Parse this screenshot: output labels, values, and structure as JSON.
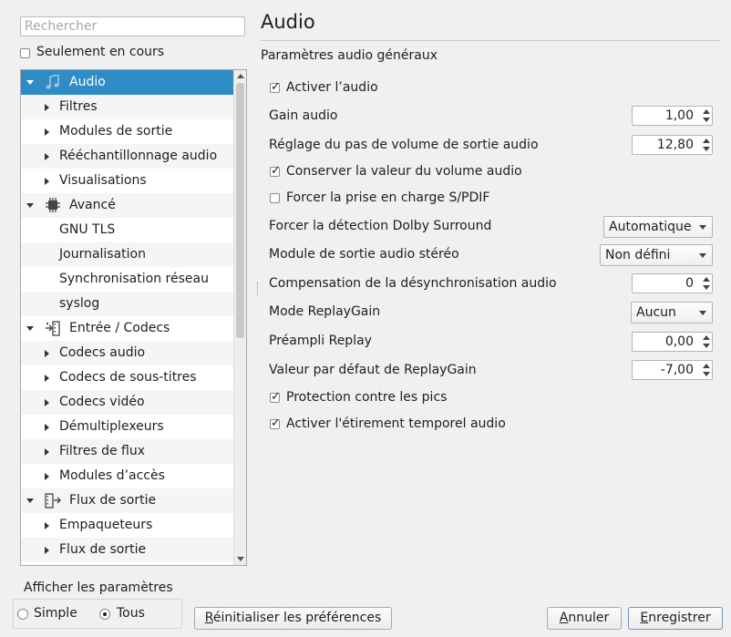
{
  "search": {
    "placeholder": "Rechercher"
  },
  "only_current": {
    "label": "Seulement en cours",
    "checked": false
  },
  "tree": {
    "items": [
      {
        "label": "Audio",
        "level": 0,
        "expanded": true,
        "icon": "music-note-icon",
        "selected": true
      },
      {
        "label": "Filtres",
        "level": 1,
        "expander": true
      },
      {
        "label": "Modules de sortie",
        "level": 1,
        "expander": true
      },
      {
        "label": "Rééchantillonnage audio",
        "level": 1,
        "expander": true
      },
      {
        "label": "Visualisations",
        "level": 1,
        "expander": true
      },
      {
        "label": "Avancé",
        "level": 0,
        "expanded": true,
        "icon": "cpu-chip-icon"
      },
      {
        "label": "GNU TLS",
        "level": 1,
        "expander": false
      },
      {
        "label": "Journalisation",
        "level": 1,
        "expander": false
      },
      {
        "label": "Synchronisation réseau",
        "level": 1,
        "expander": false
      },
      {
        "label": "syslog",
        "level": 1,
        "expander": false
      },
      {
        "label": "Entrée / Codecs",
        "level": 0,
        "expanded": true,
        "icon": "input-codecs-icon"
      },
      {
        "label": "Codecs audio",
        "level": 1,
        "expander": true
      },
      {
        "label": "Codecs de sous-titres",
        "level": 1,
        "expander": true
      },
      {
        "label": "Codecs vidéo",
        "level": 1,
        "expander": true
      },
      {
        "label": "Démultiplexeurs",
        "level": 1,
        "expander": true
      },
      {
        "label": "Filtres de flux",
        "level": 1,
        "expander": true
      },
      {
        "label": "Modules d’accès",
        "level": 1,
        "expander": true
      },
      {
        "label": "Flux de sortie",
        "level": 0,
        "expanded": true,
        "icon": "stream-output-icon"
      },
      {
        "label": "Empaqueteurs",
        "level": 1,
        "expander": true
      },
      {
        "label": "Flux de sortie",
        "level": 1,
        "expander": true
      }
    ]
  },
  "panel": {
    "title": "Audio",
    "section": "Paramètres audio généraux",
    "enable_audio": {
      "label": "Activer l’audio",
      "checked": true
    },
    "gain": {
      "label": "Gain audio",
      "value": "1,00"
    },
    "volume_step": {
      "label": "Réglage du pas de volume de sortie audio",
      "value": "12,80"
    },
    "keep_volume": {
      "label": "Conserver la valeur du volume audio",
      "checked": true
    },
    "force_spdif": {
      "label": "Forcer la prise en charge S/PDIF",
      "checked": false
    },
    "dolby": {
      "label": "Forcer la détection Dolby Surround",
      "value": "Automatique"
    },
    "stereo": {
      "label": "Module de sortie audio stéréo",
      "value": "Non défini"
    },
    "desync": {
      "label": "Compensation de la désynchronisation audio",
      "value": "0"
    },
    "replaygain_mode": {
      "label": "Mode ReplayGain",
      "value": "Aucun"
    },
    "preamp": {
      "label": "Préampli Replay",
      "value": "0,00"
    },
    "replaygain_default": {
      "label": "Valeur par défaut de ReplayGain",
      "value": "-7,00"
    },
    "peak_protection": {
      "label": "Protection contre les pics",
      "checked": true
    },
    "time_stretch": {
      "label": "Activer l'étirement temporel audio",
      "checked": true
    }
  },
  "show_settings": {
    "label": "Afficher les paramètres",
    "simple": {
      "label": "Simple",
      "selected": false
    },
    "all": {
      "label": "Tous",
      "selected": true
    }
  },
  "buttons": {
    "reset": {
      "first": "R",
      "rest": "éinitialiser les préférences"
    },
    "cancel": {
      "first": "A",
      "rest": "nnuler"
    },
    "save": {
      "first": "E",
      "rest": "nregistrer"
    }
  },
  "colors": {
    "selection": "#308cc6",
    "background": "#f0f0f0"
  }
}
